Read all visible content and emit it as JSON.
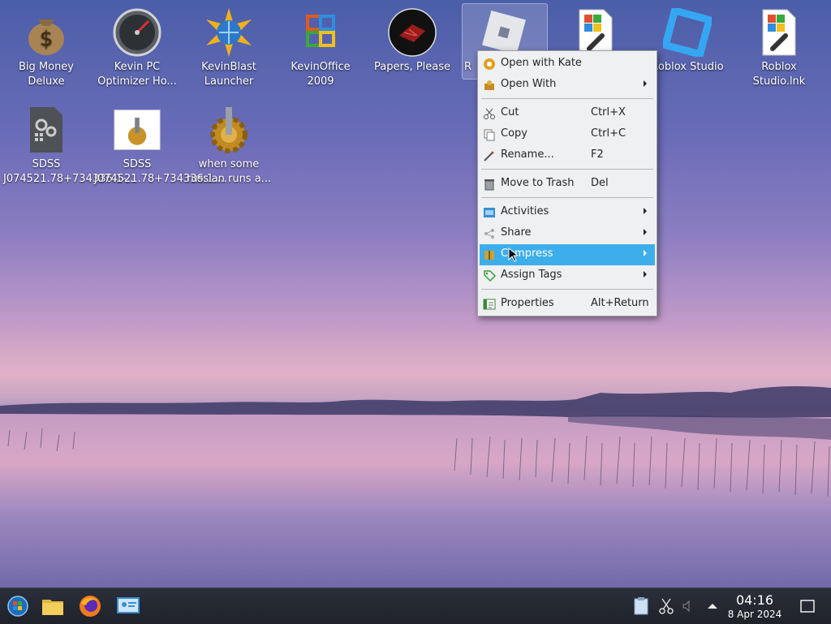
{
  "desktop": {
    "icons": [
      {
        "label": "Big Money Deluxe"
      },
      {
        "label": "Kevin PC Optimizer Ho..."
      },
      {
        "label": "KevinBlast Launcher"
      },
      {
        "label": "KevinOffice 2009"
      },
      {
        "label": "Papers, Please"
      },
      {
        "label": "R"
      },
      {
        "label": "Roblox Studio"
      },
      {
        "label": "Roblox Studio.lnk"
      },
      {
        "label": "SDSS J074521.78+734336.1-..."
      },
      {
        "label": "SDSS J074521.78+734336.1...."
      },
      {
        "label": "when some russian runs a..."
      }
    ]
  },
  "context_menu": {
    "items": [
      {
        "label": "Open with Kate",
        "shortcut": ""
      },
      {
        "label": "Open With",
        "shortcut": ""
      },
      {
        "label": "Cut",
        "shortcut": "Ctrl+X"
      },
      {
        "label": "Copy",
        "shortcut": "Ctrl+C"
      },
      {
        "label": "Rename...",
        "shortcut": "F2"
      },
      {
        "label": "Move to Trash",
        "shortcut": "Del"
      },
      {
        "label": "Activities",
        "shortcut": ""
      },
      {
        "label": "Share",
        "shortcut": ""
      },
      {
        "label": "Compress",
        "shortcut": ""
      },
      {
        "label": "Assign Tags",
        "shortcut": ""
      },
      {
        "label": "Properties",
        "shortcut": "Alt+Return"
      }
    ],
    "highlight_color": "#3daee9"
  },
  "taskbar": {
    "time": "04:16",
    "date": "8 Apr 2024"
  }
}
